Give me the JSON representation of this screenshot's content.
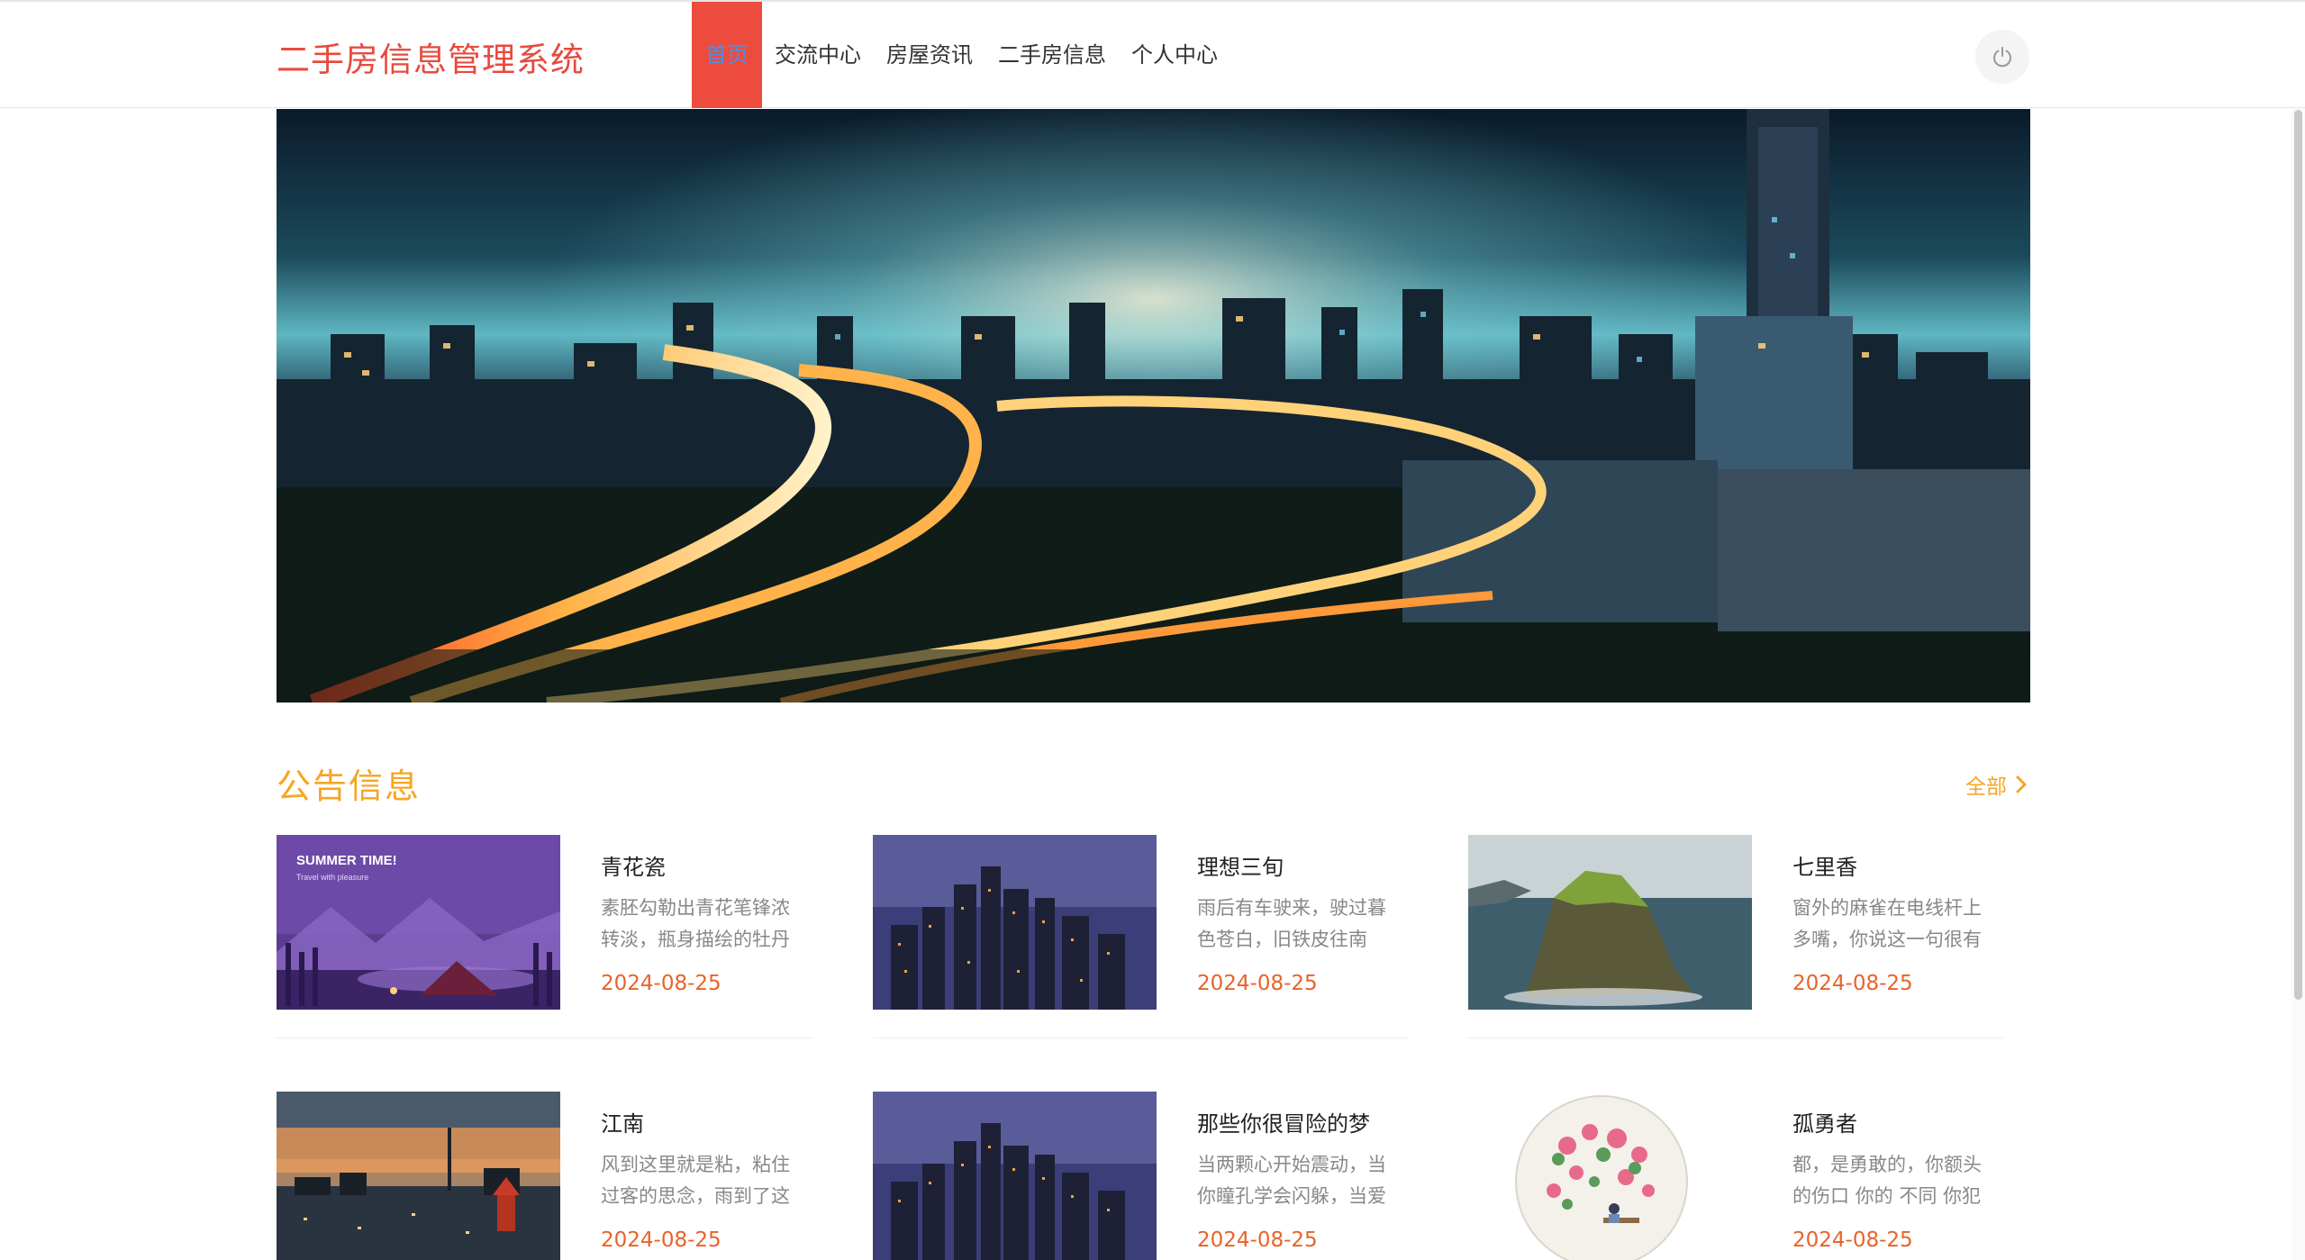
{
  "header": {
    "logo": "二手房信息管理系统",
    "nav": [
      {
        "label": "首页",
        "active": true
      },
      {
        "label": "交流中心"
      },
      {
        "label": "房屋资讯"
      },
      {
        "label": "二手房信息"
      },
      {
        "label": "个人中心"
      }
    ],
    "power_icon": "power-icon"
  },
  "banner": {
    "image": "city-night-highway-banner"
  },
  "notices": {
    "title": "公告信息",
    "more_label": "全部",
    "items": [
      {
        "title": "青花瓷",
        "desc": "素胚勾勒出青花笔锋浓转淡，瓶身描绘的牡丹",
        "date": "2024-08-25",
        "image": "summer-time-illustration",
        "image_text_1": "SUMMER TIME!",
        "image_text_2": "Travel with pleasure"
      },
      {
        "title": "理想三旬",
        "desc": "雨后有车驶来，驶过暮色苍白，旧铁皮往南",
        "date": "2024-08-25",
        "image": "city-skyline-dusk"
      },
      {
        "title": "七里香",
        "desc": "窗外的麻雀在电线杆上多嘴，你说这一句很有",
        "date": "2024-08-25",
        "image": "sea-cliff-island"
      },
      {
        "title": "江南",
        "desc": "风到这里就是粘，粘住过客的思念，雨到了这",
        "date": "2024-08-25",
        "image": "river-city-sunset"
      },
      {
        "title": "那些你很冒险的梦",
        "desc": "当两颗心开始震动，当你瞳孔学会闪躲，当爱",
        "date": "2024-08-25",
        "image": "city-skyline-dusk"
      },
      {
        "title": "孤勇者",
        "desc": "都，是勇敢的，你额头的伤口 你的 不同 你犯",
        "date": "2024-08-25",
        "image": "circular-flower-painting"
      }
    ]
  },
  "colors": {
    "accent": "#e84a3e",
    "nav_active_bg": "#ee4b3f",
    "section_title": "#f5a623",
    "date": "#e8632a"
  }
}
